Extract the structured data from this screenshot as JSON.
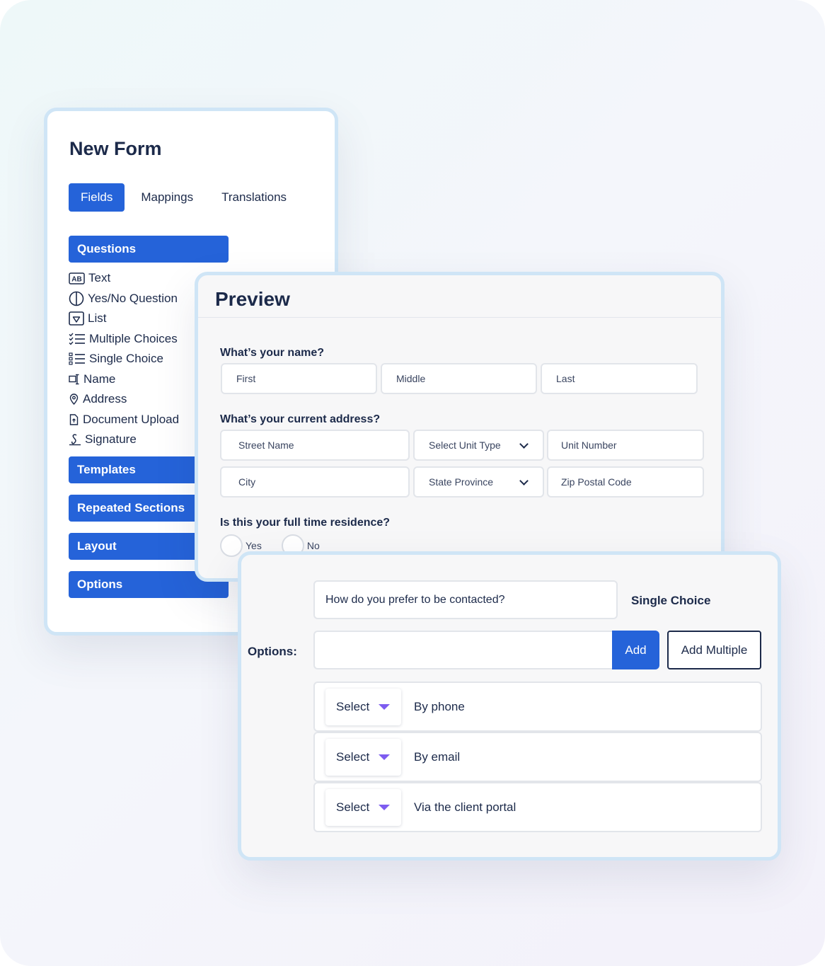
{
  "form": {
    "title": "New Form",
    "tabs": [
      "Fields",
      "Mappings",
      "Translations"
    ],
    "sections": {
      "questions": "Questions",
      "templates": "Templates",
      "repeated": "Repeated Sections",
      "layout": "Layout",
      "options": "Options"
    },
    "question_types": [
      {
        "label": "Text",
        "icon": "text-ab-icon"
      },
      {
        "label": "Yes/No Question",
        "icon": "yes-no-circle-icon"
      },
      {
        "label": "List",
        "icon": "list-dropdown-icon"
      },
      {
        "label": "Multiple Choices",
        "icon": "checklist-icon"
      },
      {
        "label": "Single Choice",
        "icon": "radio-list-icon"
      },
      {
        "label": "Name",
        "icon": "name-tag-icon"
      },
      {
        "label": "Address",
        "icon": "location-pin-icon"
      },
      {
        "label": "Document Upload",
        "icon": "document-upload-icon"
      },
      {
        "label": "Signature",
        "icon": "signature-icon"
      }
    ]
  },
  "preview": {
    "title": "Preview",
    "name_question": "What’s your name?",
    "name_fields": [
      "First",
      "Middle",
      "Last"
    ],
    "address_question": "What’s your current address?",
    "address_fields": {
      "street": "Street Name",
      "unit_type": "Select Unit Type",
      "unit_number": "Unit Number",
      "city": "City",
      "state": "State Province",
      "zip": "Zip Postal Code"
    },
    "residence_question": "Is this your full time residence?",
    "residence_options": [
      "Yes",
      "No"
    ]
  },
  "options_editor": {
    "question_text": "How do you prefer to be contacted?",
    "question_type": "Single Choice",
    "options_label": "Options:",
    "add_label": "Add",
    "add_multiple_label": "Add Multiple",
    "option_rows": [
      {
        "select": "Select",
        "text": "By phone"
      },
      {
        "select": "Select",
        "text": "By email"
      },
      {
        "select": "Select",
        "text": "Via the client portal"
      }
    ]
  },
  "colors": {
    "accent": "#2563d9",
    "text": "#1c2a4a",
    "card_border": "#cfe5f6",
    "caret": "#7d5cf0"
  }
}
